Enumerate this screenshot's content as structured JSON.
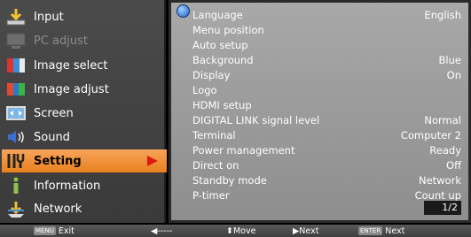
{
  "left_menu": {
    "items": [
      {
        "label": "Input",
        "icon": "input-icon"
      },
      {
        "label": "PC adjust",
        "icon": "pc-adjust-icon"
      },
      {
        "label": "Image select",
        "icon": "image-select-icon"
      },
      {
        "label": "Image adjust",
        "icon": "image-adjust-icon"
      },
      {
        "label": "Screen",
        "icon": "screen-icon"
      },
      {
        "label": "Sound",
        "icon": "sound-icon"
      },
      {
        "label": "Setting",
        "icon": "setting-icon"
      },
      {
        "label": "Information",
        "icon": "information-icon"
      },
      {
        "label": "Network",
        "icon": "network-icon"
      }
    ],
    "selected": "Setting",
    "disabled": "PC adjust"
  },
  "settings": {
    "rows": [
      {
        "label": "Language",
        "value": "English"
      },
      {
        "label": "Menu position",
        "value": ""
      },
      {
        "label": "Auto setup",
        "value": ""
      },
      {
        "label": "Background",
        "value": "Blue"
      },
      {
        "label": "Display",
        "value": "On"
      },
      {
        "label": "Logo",
        "value": ""
      },
      {
        "label": "HDMI setup",
        "value": ""
      },
      {
        "label": "DIGITAL LINK signal level",
        "value": "Normal"
      },
      {
        "label": "Terminal",
        "value": "Computer 2"
      },
      {
        "label": "Power management",
        "value": "Ready"
      },
      {
        "label": "Direct on",
        "value": "Off"
      },
      {
        "label": "Standby mode",
        "value": "Network"
      },
      {
        "label": "P-timer",
        "value": "Count up"
      }
    ],
    "page_indicator": "1/2"
  },
  "status_bar": {
    "menu_key": "MENU",
    "exit": "Exit",
    "back": "◀-----",
    "move": "⬍Move",
    "next_arrow": "▶Next",
    "enter_key": "ENTER",
    "enter_next": "Next"
  },
  "colors": {
    "selected_bg": "#ee8a2e",
    "arrow": "#e01a10",
    "panel_bg": "#9c9c9c",
    "menu_bg": "#434343"
  }
}
